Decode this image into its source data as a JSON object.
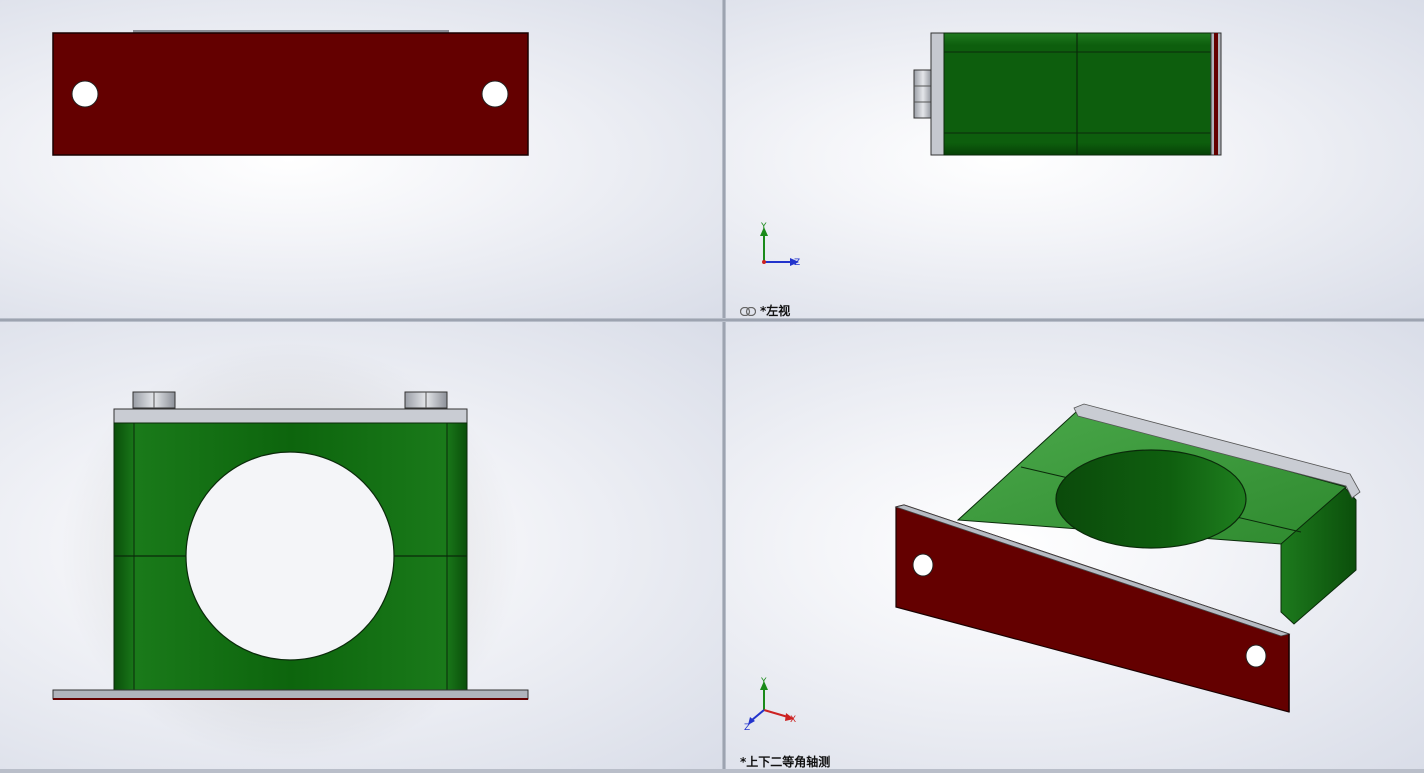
{
  "viewports": {
    "top_left": {
      "label": ""
    },
    "top_right": {
      "label": "*左视",
      "triad": {
        "y": "Y",
        "z": "Z"
      }
    },
    "bottom_left": {
      "label": ""
    },
    "bottom_right": {
      "label": "*上下二等角轴测",
      "triad": {
        "y": "Y",
        "x": "X",
        "z": "Z"
      }
    }
  },
  "colors": {
    "plate_red": "#640000",
    "clamp_green": "#0a5c0a",
    "clamp_green_light": "#3a9a3a",
    "metal_grey": "#b8bcc4",
    "background": "#f3f4f8"
  },
  "icons": [
    "link-icon",
    "coordinate-triad-icon"
  ]
}
